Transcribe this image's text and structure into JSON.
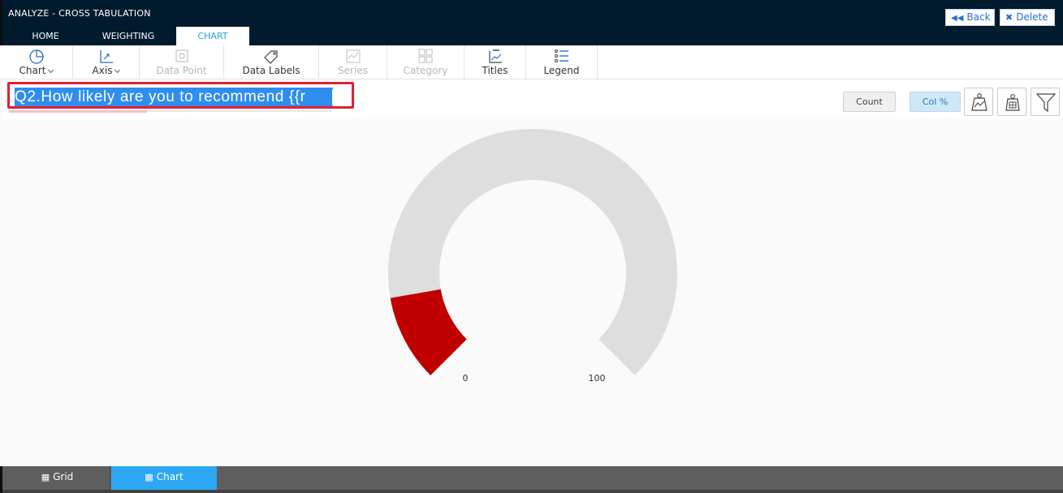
{
  "header": {
    "title": "ANALYZE - CROSS TABULATION",
    "back_label": "Back",
    "delete_label": "Delete"
  },
  "tabs": [
    {
      "label": "HOME"
    },
    {
      "label": "WEIGHTING"
    },
    {
      "label": "CHART",
      "active": true
    }
  ],
  "toolbar": {
    "items": [
      {
        "label": "Chart",
        "icon": "pie-chart-icon",
        "dropdown": true,
        "enabled": true
      },
      {
        "label": "Axis",
        "icon": "axis-icon",
        "dropdown": true,
        "enabled": true
      },
      {
        "label": "Data Point",
        "icon": "zoom-icon",
        "enabled": false
      },
      {
        "label": "Data Labels",
        "icon": "tag-icon",
        "enabled": true
      },
      {
        "label": "Series",
        "icon": "series-icon",
        "enabled": false
      },
      {
        "label": "Category",
        "icon": "grid-icon",
        "enabled": false
      },
      {
        "label": "Titles",
        "icon": "title-icon",
        "enabled": true
      },
      {
        "label": "Legend",
        "icon": "legend-icon",
        "enabled": true
      }
    ]
  },
  "title_input": {
    "value": "Q2.How likely are you to recommend {{r"
  },
  "options": {
    "count_label": "Count",
    "colpct_label": "Col %",
    "selected": "Col %"
  },
  "chart_data": {
    "type": "gauge",
    "min": 0,
    "max": 100,
    "tick_labels": [
      "0",
      "100"
    ],
    "value": 13,
    "colors": {
      "value": "#c00000",
      "track": "#dedede"
    }
  },
  "footer": {
    "grid_label": "Grid",
    "chart_label": "Chart",
    "active": "Chart"
  }
}
